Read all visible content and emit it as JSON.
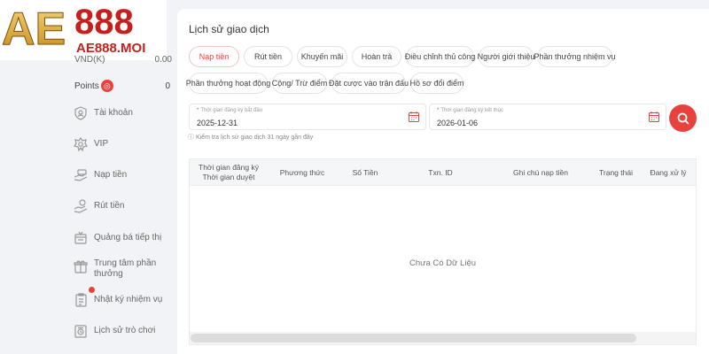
{
  "brand": {
    "logo_main": "AE888",
    "logo_sub": "AE888.MOI"
  },
  "sidebar": {
    "currency_label": "VND(K)",
    "currency_value": "0.00",
    "points_label": "Points",
    "points_value": "0",
    "items": [
      {
        "label": "Tài khoản",
        "icon": "shield-icon"
      },
      {
        "label": "VIP",
        "icon": "vip-icon"
      },
      {
        "label": "Nạp tiền",
        "icon": "deposit-icon"
      },
      {
        "label": "Rút tiền",
        "icon": "withdraw-icon"
      },
      {
        "label": "Quảng bá tiếp thị",
        "icon": "promotion-icon"
      },
      {
        "label": "Trung tâm phần thưởng",
        "icon": "gift-icon"
      },
      {
        "label": "Nhật ký nhiệm vụ",
        "icon": "task-log-icon"
      },
      {
        "label": "Lịch sử trò chơi",
        "icon": "game-history-icon"
      }
    ]
  },
  "main": {
    "title": "Lịch sử giao dịch",
    "tabs": [
      {
        "label": "Nạp tiền",
        "active": true
      },
      {
        "label": "Rút tiền"
      },
      {
        "label": "Khuyến mãi"
      },
      {
        "label": "Hoàn trả"
      },
      {
        "label": "Điều chỉnh thủ công"
      },
      {
        "label": "Người giới thiệu"
      },
      {
        "label": "Phần thưởng nhiệm vụ"
      },
      {
        "label": "Phần thưởng hoạt động"
      },
      {
        "label": "Cộng/ Trừ điểm"
      },
      {
        "label": "Đặt cược vào trận đấu"
      },
      {
        "label": "Hồ sơ đổi điểm"
      }
    ],
    "start_date": {
      "caption": "Thời gian đăng ký bắt đầu",
      "value": "2025-12-31"
    },
    "end_date": {
      "caption": "Thời gian đăng ký kết thúc",
      "value": "2026-01-06"
    },
    "hint": "Kiểm tra lịch sử giao dịch 31 ngày gần đây",
    "table": {
      "col1_line1": "Thời gian đăng ký",
      "col1_line2": "Thời gian duyệt",
      "columns": [
        "Phương thức",
        "Số Tiền",
        "Txn. ID",
        "Ghi chú nạp tiền",
        "Trạng thái",
        "Đang xử lý"
      ],
      "empty_text": "Chưa Có Dữ Liệu"
    }
  },
  "colors": {
    "accent": "#e8423e",
    "logo_gold": "#d9a62e",
    "logo_red": "#c7201c"
  }
}
